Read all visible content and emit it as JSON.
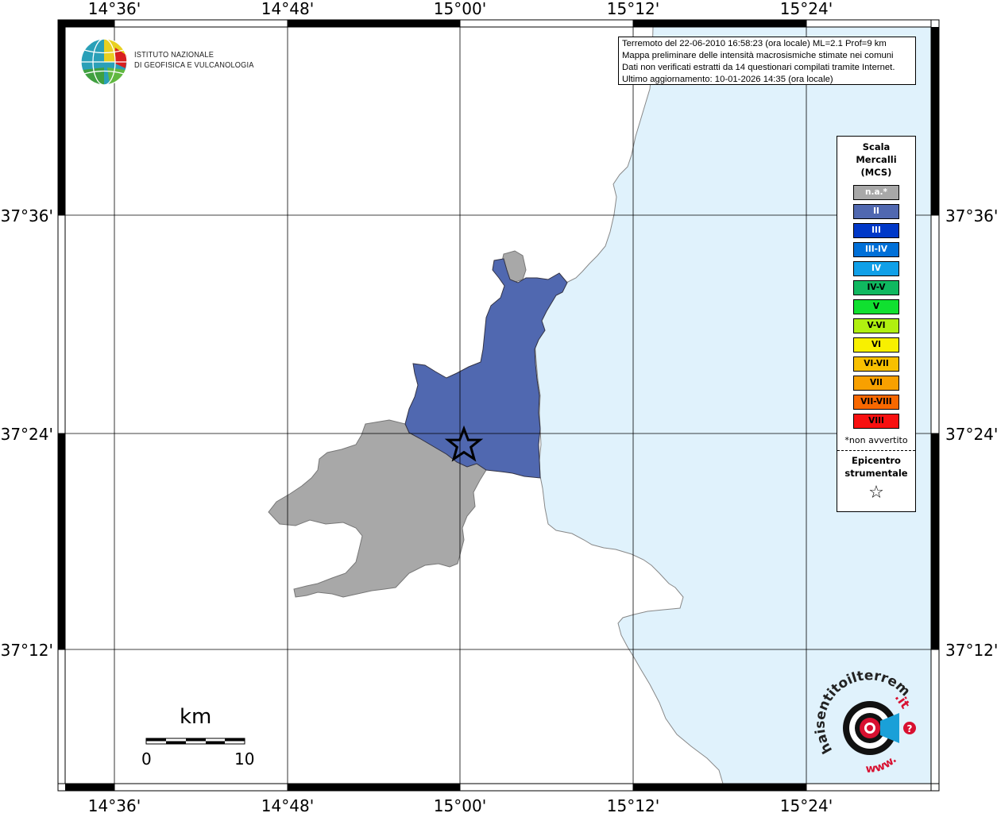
{
  "info": {
    "line1": "Terremoto del 22-06-2010 16:58:23 (ora locale) ML=2.1 Prof=9 km",
    "line2": "Mappa preliminare delle intensità macrosismiche stimate nei comuni",
    "line3": "Dati non verificati estratti da 14 questionari compilati tramite Internet.",
    "line4": "Ultimo aggiornamento: 10-01-2026 14:35 (ora locale)"
  },
  "logo": {
    "line1": "ISTITUTO NAZIONALE",
    "line2": "DI GEOFISICA E VULCANOLOGIA"
  },
  "ticks": {
    "lon": [
      "14°36'",
      "14°48'",
      "15°00'",
      "15°12'",
      "15°24'"
    ],
    "lat": [
      "37°36'",
      "37°24'",
      "37°12'"
    ]
  },
  "legend": {
    "title1": "Scala",
    "title2": "Mercalli",
    "title3": "(MCS)",
    "items": [
      {
        "label": "n.a.*",
        "color": "#a8a8a8",
        "text_color": "#ffffff"
      },
      {
        "label": "II",
        "color": "#5068b0",
        "text_color": "#ffffff"
      },
      {
        "label": "III",
        "color": "#0038c8",
        "text_color": "#ffffff"
      },
      {
        "label": "III-IV",
        "color": "#0070d8",
        "text_color": "#ffffff"
      },
      {
        "label": "IV",
        "color": "#10a0e8",
        "text_color": "#ffffff"
      },
      {
        "label": "IV-V",
        "color": "#10b860",
        "text_color": "#000000"
      },
      {
        "label": "V",
        "color": "#10e030",
        "text_color": "#000000"
      },
      {
        "label": "V-VI",
        "color": "#b0f010",
        "text_color": "#000000"
      },
      {
        "label": "VI",
        "color": "#f8f000",
        "text_color": "#000000"
      },
      {
        "label": "VI-VII",
        "color": "#f8c000",
        "text_color": "#000000"
      },
      {
        "label": "VII",
        "color": "#f8a000",
        "text_color": "#000000"
      },
      {
        "label": "VII-VIII",
        "color": "#f86800",
        "text_color": "#000000"
      },
      {
        "label": "VIII",
        "color": "#f81010",
        "text_color": "#000000"
      }
    ],
    "note": "*non avvertito",
    "epi1": "Epicentro",
    "epi2": "strumentale",
    "star": "☆"
  },
  "scalebar": {
    "unit": "km",
    "start": "0",
    "end": "10"
  },
  "hsit_logo": {
    "prefix": "www.",
    "main": "haisentitoilterremoto",
    "suffix": ".it",
    "question": "?"
  },
  "colors": {
    "sea": "#e0f2fc",
    "intensity_II": "#5068b0",
    "not_felt": "#a8a8a8"
  }
}
